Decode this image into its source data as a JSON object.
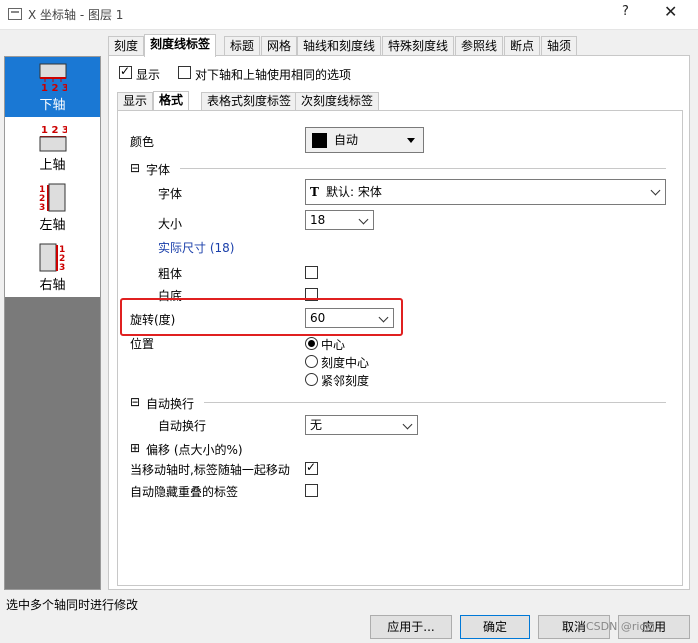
{
  "window": {
    "title": "X 坐标轴 - 图层 1",
    "help": "?",
    "close": "✕"
  },
  "axes": [
    {
      "label": "下轴",
      "icon": "bottom-axis-icon",
      "digits": "123"
    },
    {
      "label": "上轴",
      "icon": "top-axis-icon",
      "digits": "123"
    },
    {
      "label": "左轴",
      "icon": "left-axis-icon",
      "digits": "123"
    },
    {
      "label": "右轴",
      "icon": "right-axis-icon",
      "digits": "123"
    }
  ],
  "tabs": [
    "刻度",
    "刻度线标签",
    "标题",
    "网格",
    "轴线和刻度线",
    "特殊刻度线",
    "参照线",
    "断点",
    "轴须"
  ],
  "options": {
    "show": "显示",
    "same_as_top": "对下轴和上轴使用相同的选项"
  },
  "subtabs": [
    "显示",
    "格式",
    "表格式刻度标签",
    "次刻度线标签"
  ],
  "format": {
    "color_label": "颜色",
    "color_value": "自动",
    "font_section": "字体",
    "font_label": "字体",
    "font_value": "默认: 宋体",
    "size_label": "大小",
    "size_value": "18",
    "actual_size": "实际尺寸 (18)",
    "bold_label": "粗体",
    "whitebg_label": "白底",
    "rotate_label": "旋转(度)",
    "rotate_value": "60",
    "position_label": "位置",
    "position_options": [
      "中心",
      "刻度中心",
      "紧邻刻度"
    ],
    "wrap_section": "自动换行",
    "wrap_label": "自动换行",
    "wrap_value": "无",
    "offset_section": "偏移 (点大小的%)",
    "move_with_axis": "当移动轴时,标签随轴一起移动",
    "auto_hide": "自动隐藏重叠的标签"
  },
  "status": "选中多个轴同时进行修改",
  "buttons": {
    "apply_to": "应用于...",
    "ok": "确定",
    "cancel": "取消",
    "apply": "应用"
  },
  "watermark": "CSDN @ricki",
  "colors": {
    "selected": "#1a78d4",
    "highlight": "#e02020",
    "link": "#1a3faa"
  }
}
